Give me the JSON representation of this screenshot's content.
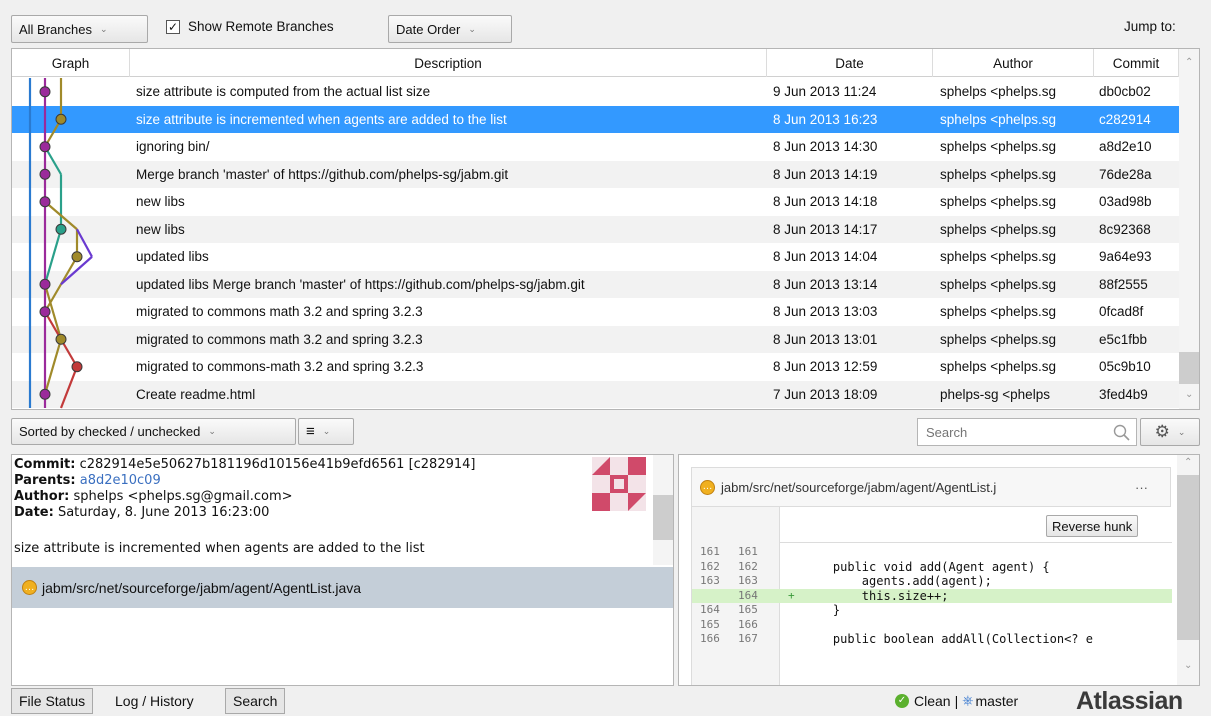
{
  "toolbar": {
    "branches_label": "All Branches",
    "show_remote_label": "Show Remote Branches",
    "show_remote_checked": true,
    "order_label": "Date Order",
    "jump_to_label": "Jump to:"
  },
  "log": {
    "columns": [
      "Graph",
      "Description",
      "Date",
      "Author",
      "Commit"
    ],
    "selected_index": 1,
    "rows": [
      {
        "description": "size attribute is computed from the actual list size",
        "date": "9 Jun 2013 11:24",
        "author": "sphelps <phelps.sg",
        "commit": "db0cb02"
      },
      {
        "description": "size attribute is incremented when agents are added to the list",
        "date": "8 Jun 2013 16:23",
        "author": "sphelps <phelps.sg",
        "commit": "c282914"
      },
      {
        "description": "ignoring bin/",
        "date": "8 Jun 2013 14:30",
        "author": "sphelps <phelps.sg",
        "commit": "a8d2e10"
      },
      {
        "description": "Merge branch 'master' of https://github.com/phelps-sg/jabm.git",
        "date": "8 Jun 2013 14:19",
        "author": "sphelps <phelps.sg",
        "commit": "76de28a"
      },
      {
        "description": "new libs",
        "date": "8 Jun 2013 14:18",
        "author": "sphelps <phelps.sg",
        "commit": "03ad98b"
      },
      {
        "description": "new libs",
        "date": "8 Jun 2013 14:17",
        "author": "sphelps <phelps.sg",
        "commit": "8c92368"
      },
      {
        "description": "updated libs",
        "date": "8 Jun 2013 14:04",
        "author": "sphelps <phelps.sg",
        "commit": "9a64e93"
      },
      {
        "description": "updated libs Merge branch 'master' of https://github.com/phelps-sg/jabm.git",
        "date": "8 Jun 2013 13:14",
        "author": "sphelps <phelps.sg",
        "commit": "88f2555"
      },
      {
        "description": "migrated to commons math 3.2 and spring 3.2.3",
        "date": "8 Jun 2013 13:03",
        "author": "sphelps <phelps.sg",
        "commit": "0fcad8f"
      },
      {
        "description": "migrated to commons math 3.2 and spring 3.2.3",
        "date": "8 Jun 2013 13:01",
        "author": "sphelps <phelps.sg",
        "commit": "e5c1fbb"
      },
      {
        "description": "migrated to commons-math 3.2 and spring 3.2.3",
        "date": "8 Jun 2013 12:59",
        "author": "sphelps <phelps.sg",
        "commit": "05c9b10"
      },
      {
        "description": "Create readme.html",
        "date": "7 Jun 2013 18:09",
        "author": "phelps-sg <phelps",
        "commit": "3fed4b9"
      }
    ]
  },
  "midbar": {
    "sort_label": "Sorted by checked / unchecked",
    "search_placeholder": "Search"
  },
  "details": {
    "commit_label": "Commit:",
    "commit_value": "c282914e5e50627b181196d10156e41b9efd6561 [c282914]",
    "parents_label": "Parents:",
    "parents_value": "a8d2e10c09",
    "author_label": "Author:",
    "author_value": "sphelps <phelps.sg@gmail.com>",
    "date_label": "Date:",
    "date_value": "Saturday, 8. June 2013 16:23:00",
    "message": "size attribute is incremented when agents are added to the list",
    "file": "jabm/src/net/sourceforge/jabm/agent/AgentList.java"
  },
  "diff": {
    "file_header": "jabm/src/net/sourceforge/jabm/agent/AgentList.j",
    "more_label": "···",
    "reverse_hunk_label": "Reverse hunk",
    "lines": [
      {
        "old": "161",
        "new": "161",
        "marker": "",
        "code": "",
        "added": false
      },
      {
        "old": "162",
        "new": "162",
        "marker": "",
        "code": "    public void add(Agent agent) {",
        "added": false
      },
      {
        "old": "163",
        "new": "163",
        "marker": "",
        "code": "        agents.add(agent);",
        "added": false
      },
      {
        "old": "",
        "new": "164",
        "marker": "+",
        "code": "        this.size++;",
        "added": true
      },
      {
        "old": "164",
        "new": "165",
        "marker": "",
        "code": "    }",
        "added": false
      },
      {
        "old": "165",
        "new": "166",
        "marker": "",
        "code": "",
        "added": false
      },
      {
        "old": "166",
        "new": "167",
        "marker": "",
        "code": "    public boolean addAll(Collection<? e",
        "added": false
      }
    ]
  },
  "bottom": {
    "tabs": [
      "File Status",
      "Log / History",
      "Search"
    ],
    "active_tab": "Log / History",
    "status_clean": "Clean",
    "separator": "|",
    "branch": "master",
    "brand": "Atlassian"
  },
  "colors": {
    "selection": "#3399ff",
    "graph_purple": "#9b2a9b",
    "graph_olive": "#a08a2a",
    "graph_teal": "#2aa08a",
    "graph_red": "#c23a3a",
    "graph_violet": "#6a3ad0",
    "graph_blue": "#2a7ad0",
    "added_line": "#d6f2c8",
    "brand": "#3a3a3a"
  },
  "icons": {
    "remote_branch": "checkbox-checked-icon",
    "search": "magnifier-icon",
    "settings": "gear-icon",
    "file_status": "modified-file-icon",
    "clean": "check-circle-icon",
    "branch": "branch-icon"
  }
}
